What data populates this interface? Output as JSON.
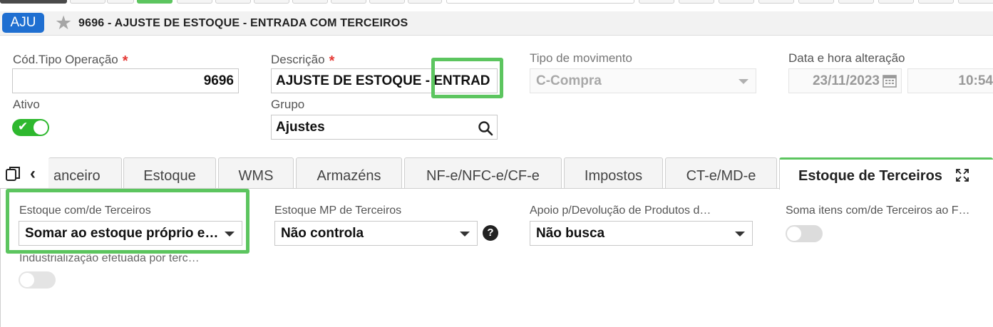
{
  "header": {
    "badge": "AJU",
    "title": "9696 - AJUSTE DE ESTOQUE - ENTRADA COM TERCEIROS"
  },
  "form": {
    "cod_tipo_label": "Cód.Tipo Operação",
    "cod_tipo_value": "9696",
    "descricao_label": "Descrição",
    "descricao_value": "AJUSTE DE ESTOQUE - ENTRAD",
    "tipo_mov_label": "Tipo de movimento",
    "tipo_mov_value": "C-Compra",
    "data_label": "Data e hora alteração",
    "data_value": "23/11/2023",
    "hora_value": "10:54",
    "ativo_label": "Ativo",
    "ativo_on": true,
    "grupo_label": "Grupo",
    "grupo_value": "Ajustes",
    "required_mark": "*"
  },
  "tabs": [
    {
      "label": "anceiro"
    },
    {
      "label": "Estoque"
    },
    {
      "label": "WMS"
    },
    {
      "label": "Armazéns"
    },
    {
      "label": "NF-e/NFC-e/CF-e"
    },
    {
      "label": "Impostos"
    },
    {
      "label": "CT-e/MD-e"
    },
    {
      "label": "Estoque de Terceiros",
      "active": true
    }
  ],
  "terceiros": {
    "estoque_label": "Estoque com/de Terceiros",
    "estoque_value": "Somar ao estoque próprio e…",
    "mp_label": "Estoque MP de Terceiros",
    "mp_value": "Não controla",
    "apoio_label": "Apoio p/Devolução de Produtos d…",
    "apoio_value": "Não busca",
    "soma_label": "Soma itens com/de Terceiros ao F…",
    "soma_on": false,
    "industrializacao_label": "Industrialização efetuada por terc…",
    "industrializacao_on": false
  },
  "colors": {
    "accent": "#1f6fd1",
    "highlight": "#5cc55f",
    "toggle_on": "#2eb82e",
    "required": "#e53935"
  }
}
